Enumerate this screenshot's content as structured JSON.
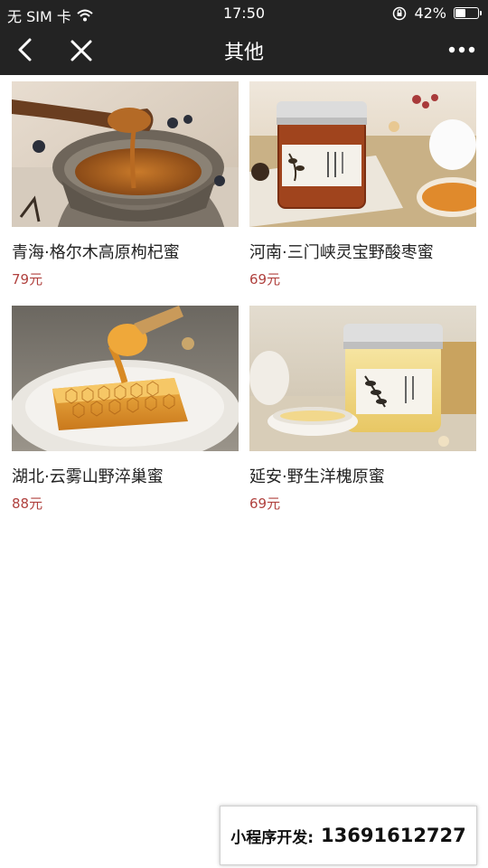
{
  "status_bar": {
    "carrier": "无 SIM 卡",
    "time": "17:50",
    "battery": "42%",
    "battery_level": 0.42
  },
  "nav": {
    "title": "其他",
    "back_icon": "chevron-left-icon",
    "close_icon": "close-icon",
    "more_icon": "more-dots-icon"
  },
  "products": [
    {
      "name": "青海·格尔木高原枸杞蜜",
      "price": "79元",
      "image": "honey-bowl-dipper-photo"
    },
    {
      "name": "河南·三门峡灵宝野酸枣蜜",
      "price": "69元",
      "image": "honey-jar-label-photo"
    },
    {
      "name": "湖北·云雾山野淬巢蜜",
      "price": "88元",
      "image": "honeycomb-plate-photo"
    },
    {
      "name": "延安·野生洋槐原蜜",
      "price": "69元",
      "image": "acacia-honey-jar-photo"
    }
  ],
  "promo": {
    "label": "小程序开发:",
    "phone": "13691612727"
  },
  "colors": {
    "bar_bg": "#232323",
    "price": "#b0413e",
    "text": "#222222"
  }
}
